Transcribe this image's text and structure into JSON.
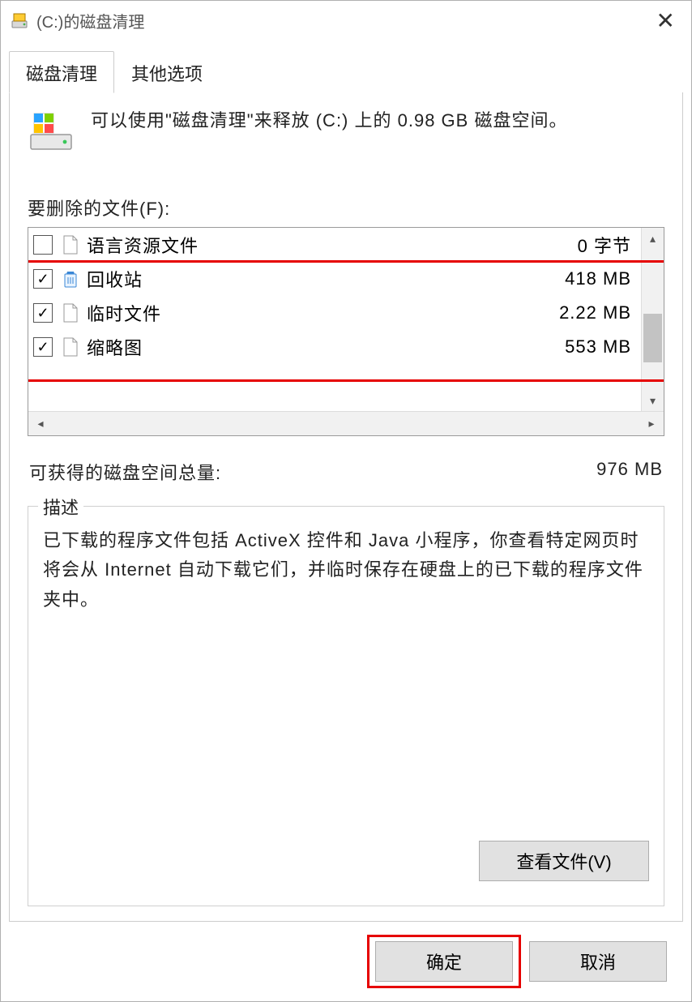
{
  "titlebar": {
    "title": "(C:)的磁盘清理"
  },
  "tabs": {
    "disk_cleanup": "磁盘清理",
    "other_options": "其他选项"
  },
  "intro": "可以使用\"磁盘清理\"来释放  (C:) 上的 0.98 GB 磁盘空间。",
  "files": {
    "section_label": "要删除的文件(F):",
    "items": [
      {
        "label": "语言资源文件",
        "size": "0 字节",
        "checked": false,
        "icon": "file"
      },
      {
        "label": "回收站",
        "size": "418 MB",
        "checked": true,
        "icon": "recycle"
      },
      {
        "label": "临时文件",
        "size": "2.22 MB",
        "checked": true,
        "icon": "file"
      },
      {
        "label": "缩略图",
        "size": "553 MB",
        "checked": true,
        "icon": "file"
      }
    ]
  },
  "gain": {
    "label": "可获得的磁盘空间总量:",
    "value": "976 MB"
  },
  "description": {
    "legend": "描述",
    "text": "已下载的程序文件包括 ActiveX 控件和 Java 小程序，你查看特定网页时将会从 Internet 自动下载它们，并临时保存在硬盘上的已下载的程序文件夹中。",
    "view_files": "查看文件(V)"
  },
  "buttons": {
    "ok": "确定",
    "cancel": "取消"
  }
}
